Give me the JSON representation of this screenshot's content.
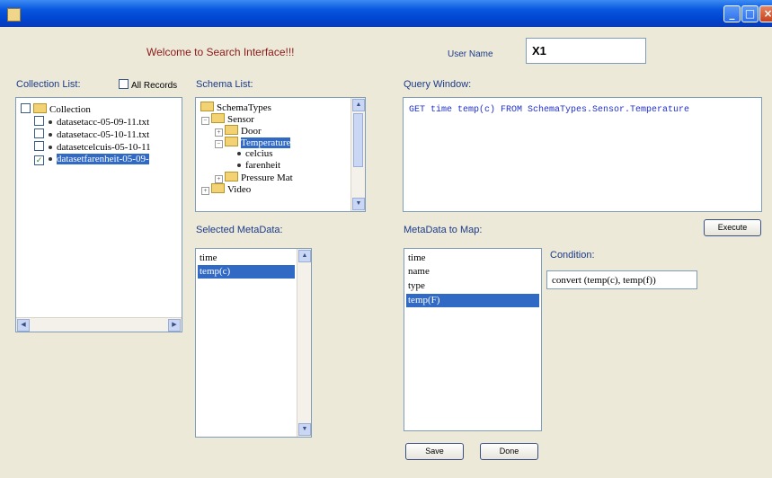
{
  "window": {
    "minimize": "_",
    "maximize": "□",
    "close": "×"
  },
  "header": {
    "welcome": "Welcome to Search Interface!!!",
    "user_label": "User Name",
    "user_value": "X1"
  },
  "collection": {
    "label": "Collection List:",
    "all_records": "All Records",
    "root": "Collection",
    "items": [
      {
        "name": "datasetacc-05-09-11.txt",
        "checked": false
      },
      {
        "name": "datasetacc-05-10-11.txt",
        "checked": false
      },
      {
        "name": "datasetcelcuis-05-10-11",
        "checked": false
      },
      {
        "name": "datasetfarenheit-05-09-",
        "checked": true
      }
    ]
  },
  "schema": {
    "label": "Schema List:",
    "root": "SchemaTypes",
    "sensor": "Sensor",
    "door": "Door",
    "temperature": "Temperature",
    "celcius": "celcius",
    "farenheit": "farenheit",
    "pressure": "Pressure Mat",
    "video": "Video"
  },
  "query": {
    "label": "Query Window:",
    "text": "GET time temp(c) FROM SchemaTypes.Sensor.Temperature",
    "execute": "Execute"
  },
  "selected_meta": {
    "label": "Selected MetaData:",
    "items": [
      "time",
      "temp(c)"
    ],
    "selected_index": 1
  },
  "map_meta": {
    "label": "MetaData to Map:",
    "items": [
      "time",
      "name",
      "type",
      "temp(F)"
    ],
    "selected_index": 3
  },
  "condition": {
    "label": "Condition:",
    "value": "convert (temp(c), temp(f))"
  },
  "buttons": {
    "save": "Save",
    "done": "Done"
  },
  "colors": {
    "titlebar": "#0A58E0",
    "selection": "#316AC5",
    "background": "#ECE9D8",
    "query_text": "#2030C8"
  }
}
